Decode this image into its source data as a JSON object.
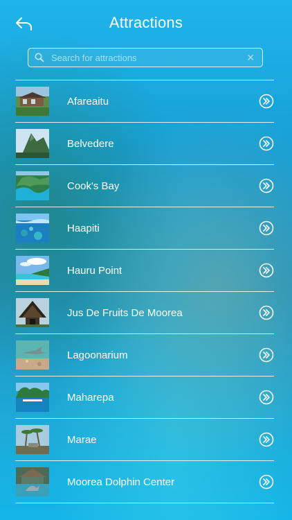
{
  "header": {
    "title": "Attractions",
    "back_icon": "back-arrow-icon"
  },
  "search": {
    "placeholder": "Search for attractions",
    "value": "",
    "icon": "search-icon",
    "clear_icon": "✕"
  },
  "attractions": [
    {
      "label": "Afareaitu",
      "thumb": "resort-building"
    },
    {
      "label": "Belvedere",
      "thumb": "mountain-peak"
    },
    {
      "label": "Cook's Bay",
      "thumb": "bay-aerial"
    },
    {
      "label": "Haapiti",
      "thumb": "underwater-reef"
    },
    {
      "label": "Hauru Point",
      "thumb": "beach-sky"
    },
    {
      "label": "Jus De Fruits De Moorea",
      "thumb": "thatched-hut"
    },
    {
      "label": "Lagoonarium",
      "thumb": "shark-water"
    },
    {
      "label": "Maharepa",
      "thumb": "green-island"
    },
    {
      "label": "Marae",
      "thumb": "palm-trees"
    },
    {
      "label": "Moorea Dolphin Center",
      "thumb": "dolphin-pool"
    }
  ],
  "colors": {
    "background": "#1fb4ea",
    "text": "#ffffff",
    "divider": "#ffffff"
  },
  "row_icon": "chevron-double-right-icon"
}
